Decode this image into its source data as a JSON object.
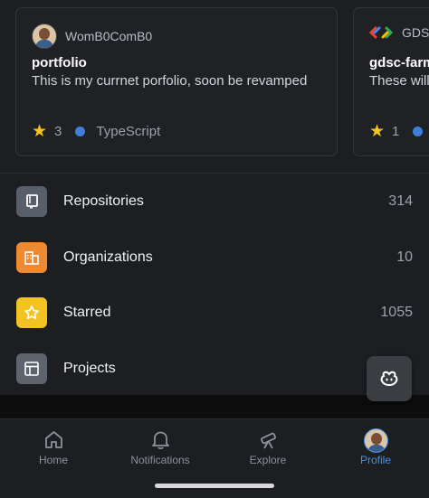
{
  "pinned": [
    {
      "owner": "WomB0ComB0",
      "name": "portfolio",
      "description": "This is my currnet porfolio, soon be revamped",
      "stars": "3",
      "language": "TypeScript",
      "language_color": "#3f7fd8"
    },
    {
      "owner": "GDSC",
      "name": "gdsc-farm",
      "description": "These will",
      "stars": "1",
      "language_color": "#3f7fd8"
    }
  ],
  "menu": [
    {
      "label": "Repositories",
      "value": "314",
      "icon": "repo-icon",
      "color": "#57606a"
    },
    {
      "label": "Organizations",
      "value": "10",
      "icon": "organization-icon",
      "color": "#ef8a34"
    },
    {
      "label": "Starred",
      "value": "1055",
      "icon": "star-icon",
      "color": "#f2c322"
    },
    {
      "label": "Projects",
      "value": "",
      "icon": "table-icon",
      "color": "#5d646d"
    }
  ],
  "fab": {
    "icon": "copilot-icon"
  },
  "tabs": [
    {
      "label": "Home",
      "icon": "home-icon"
    },
    {
      "label": "Notifications",
      "icon": "bell-icon"
    },
    {
      "label": "Explore",
      "icon": "telescope-icon"
    },
    {
      "label": "Profile",
      "icon": "avatar",
      "active": true
    }
  ],
  "colors": {
    "accent": "#4a90e2",
    "star": "#f4c51d",
    "background": "#1c1e22"
  }
}
